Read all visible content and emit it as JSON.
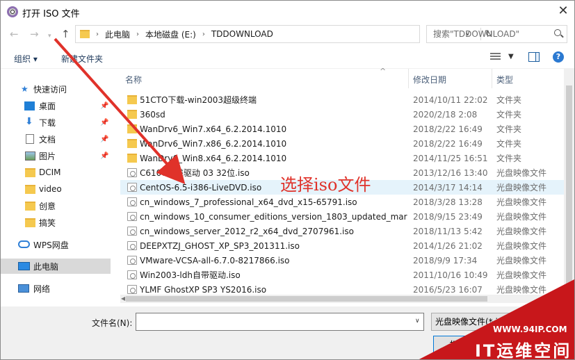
{
  "window": {
    "title": "打开 ISO 文件",
    "close_symbol": "✕"
  },
  "address": {
    "crumbs": [
      "此电脑",
      "本地磁盘 (E:)",
      "TDDOWNLOAD"
    ],
    "search_placeholder": "搜索\"TDDOWNLOAD\""
  },
  "toolbar": {
    "organize": "组织 ▾",
    "new_folder": "新建文件夹"
  },
  "nav_pane": {
    "quick_access": "快速访问",
    "items": [
      "桌面",
      "下载",
      "文档",
      "图片",
      "DCIM",
      "video",
      "创意",
      "搞笑"
    ],
    "wps": "WPS网盘",
    "this_pc": "此电脑",
    "network": "网络"
  },
  "columns": {
    "name": "名称",
    "modified": "修改日期",
    "type": "类型"
  },
  "files": [
    {
      "name": "51CTO下载-win2003超级终端",
      "date": "2014/10/11 22:02",
      "type": "文件夹",
      "kind": "folder"
    },
    {
      "name": "360sd",
      "date": "2020/2/18 2:08",
      "type": "文件夹",
      "kind": "folder"
    },
    {
      "name": "WanDrv6_Win7.x64_6.2.2014.1010",
      "date": "2018/2/22 16:49",
      "type": "文件夹",
      "kind": "folder"
    },
    {
      "name": "WanDrv6_Win7.x86_6.2.2014.1010",
      "date": "2018/2/22 16:49",
      "type": "文件夹",
      "kind": "folder"
    },
    {
      "name": "WanDrv6_Win8.x64_6.2.2014.1010",
      "date": "2014/11/25 16:51",
      "type": "文件夹",
      "kind": "folder"
    },
    {
      "name": "C6100无线驱动 03 32位.iso",
      "date": "2013/12/16 13:40",
      "type": "光盘映像文件",
      "kind": "iso"
    },
    {
      "name": "CentOS-6.5-i386-LiveDVD.iso",
      "date": "2014/3/17 14:14",
      "type": "光盘映像文件",
      "kind": "iso"
    },
    {
      "name": "cn_windows_7_professional_x64_dvd_x15-65791.iso",
      "date": "2018/3/28 13:28",
      "type": "光盘映像文件",
      "kind": "iso"
    },
    {
      "name": "cn_windows_10_consumer_editions_version_1803_updated_marc...",
      "date": "2018/9/15 23:49",
      "type": "光盘映像文件",
      "kind": "iso"
    },
    {
      "name": "cn_windows_server_2012_r2_x64_dvd_2707961.iso",
      "date": "2018/11/13 5:42",
      "type": "光盘映像文件",
      "kind": "iso"
    },
    {
      "name": "DEEPXTZJ_GHOST_XP_SP3_201311.iso",
      "date": "2014/1/26 21:02",
      "type": "光盘映像文件",
      "kind": "iso"
    },
    {
      "name": "VMware-VCSA-all-6.7.0-8217866.iso",
      "date": "2018/9/9 17:34",
      "type": "光盘映像文件",
      "kind": "iso"
    },
    {
      "name": "Win2003-ldh自带驱动.iso",
      "date": "2011/10/16 10:49",
      "type": "光盘映像文件",
      "kind": "iso"
    },
    {
      "name": "YLMF GhostXP SP3 YS2016.iso",
      "date": "2016/5/23 16:07",
      "type": "光盘映像文件",
      "kind": "iso"
    }
  ],
  "bottom": {
    "filename_label": "文件名(N):",
    "filename_value": "",
    "filetype": "光盘映像文件(*.iso)",
    "open_button": "打开(O)"
  },
  "annotation": {
    "text": "选择iso文件",
    "color": "#e0322a"
  },
  "watermark": {
    "url": "WWW.94IP.COM",
    "brand": "IT运维空间",
    "color": "#c8171b"
  }
}
